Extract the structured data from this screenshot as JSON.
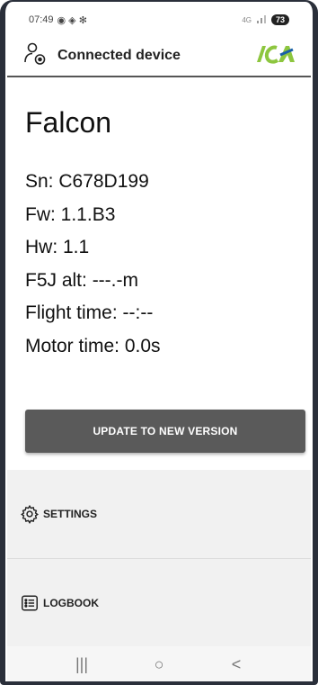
{
  "status_bar": {
    "time": "07:49",
    "indicators": "◉ ◈ ✻",
    "network": "4G",
    "battery": "73"
  },
  "app_bar": {
    "title": "Connected device",
    "logo_text": "ICA",
    "icon": "connected-user-icon"
  },
  "device": {
    "name": "Falcon",
    "sn": "Sn: C678D199",
    "fw": "Fw: 1.1.B3",
    "hw": "Hw: 1.1",
    "f5j_alt": "F5J alt: ---.-m",
    "flight_time": "Flight time: --:--",
    "motor_time": "Motor time: 0.0s"
  },
  "update_button": {
    "label": "UPDATE TO NEW VERSION"
  },
  "menu": {
    "settings": {
      "label": "SETTINGS",
      "icon": "gear-icon"
    },
    "logbook": {
      "label": "LOGBOOK",
      "icon": "list-icon"
    }
  },
  "nav": {
    "recents": "|||",
    "home": "○",
    "back": "<"
  },
  "colors": {
    "button_bg": "#5a5a5a",
    "menu_bg": "#f1f1f1",
    "logo_green": "#8dc63f",
    "logo_blue": "#1a5fa8"
  }
}
